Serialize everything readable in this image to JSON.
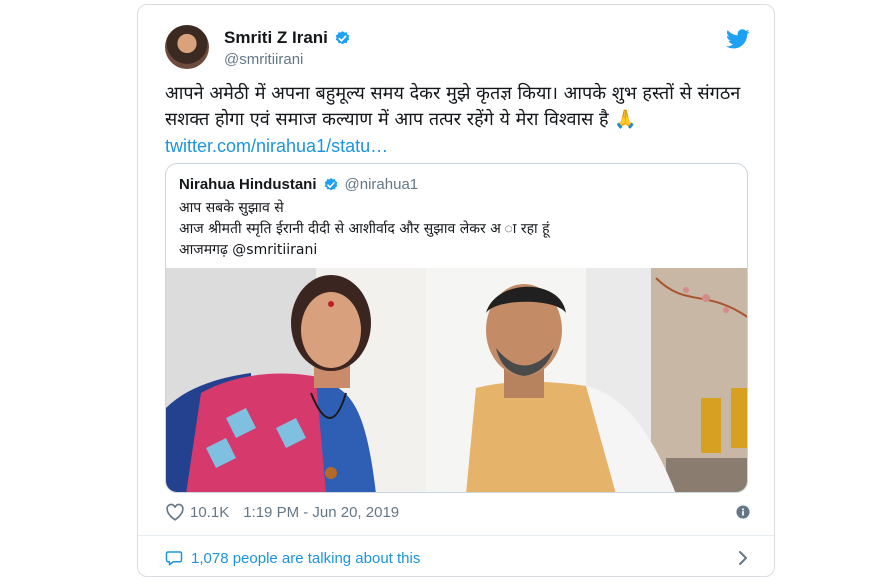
{
  "tweet": {
    "author_name": "Smriti Z Irani",
    "author_handle": "@smritiirani",
    "text": "आपने अमेठी में अपना बहुमूल्य समय देकर मुझे कृतज्ञ किया। आपके शुभ हस्तों से संगठन सशक्त होगा एवं समाज कल्याण में आप तत्पर रहेंगे ये मेरा विश्वास है",
    "emoji": "🙏",
    "link": "twitter.com/nirahua1/statu…",
    "likes": "10.1K",
    "timestamp": "1:19 PM - Jun 20, 2019",
    "conversation": "1,078 people are talking about this"
  },
  "quoted": {
    "author_name": "Nirahua Hindustani",
    "author_handle": "@nirahua1",
    "line1": "आप सबके सुझाव से",
    "line2": "आज श्रीमती स्मृति ईरानी दीदी से आशीर्वाद और सुझाव लेकर अ ा रहा हूं",
    "line3": "आजमगढ़ @smritiirani"
  },
  "icons": {
    "verified": "verified-badge-icon",
    "bird": "twitter-bird-icon",
    "heart": "heart-icon",
    "info": "info-icon",
    "bubble": "comment-bubble-icon",
    "chevron": "chevron-right-icon"
  },
  "colors": {
    "accent": "#1b95e0",
    "secondary_text": "#657786",
    "border": "#ccd6dd"
  }
}
